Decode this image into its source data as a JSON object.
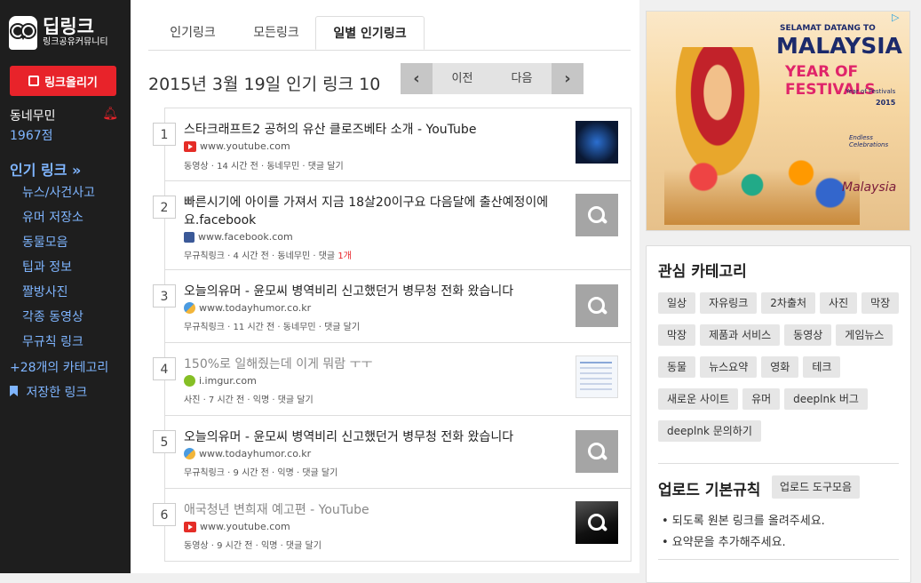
{
  "sidebar": {
    "logo_title": "딥링크",
    "logo_sub": "링크공유커뮤니티",
    "post_button": "링크올리기",
    "user_name": "동네무민",
    "user_points": "1967점",
    "nav_heading": "인기 링크",
    "categories": [
      "뉴스/사건사고",
      "유머 저장소",
      "동물모음",
      "팁과 정보",
      "짤방사진",
      "각종 동영상",
      "무규칙 링크"
    ],
    "more_categories": "+28개의 카테고리",
    "saved_links": "저장한 링크"
  },
  "tabs": [
    "인기링크",
    "모든링크",
    "일별 인기링크"
  ],
  "active_tab": "일별 인기링크",
  "date_title": "2015년 3월 19일 인기 링크 10",
  "pager": {
    "prev": "이전",
    "next": "다음"
  },
  "items": [
    {
      "rank": "1",
      "title": "스타크래프트2 공허의 유산 클로즈베타 소개 - YouTube",
      "domain": "www.youtube.com",
      "favicon": "youtube-icon",
      "meta": "동영상 · 14 시간 전 · 동네무민 · 댓글 달기",
      "meta_count": "",
      "visited": false,
      "thumb": "game-thumbnail"
    },
    {
      "rank": "2",
      "title": "빠른시기에 아이를 가져서 지금 18살20이구요 다음달에 출산예정이에요.facebook",
      "domain": "www.facebook.com",
      "favicon": "facebook-icon",
      "meta": "무규칙링크 · 4 시간 전 · 동네무민 · 댓글 ",
      "meta_count": "1개",
      "visited": false,
      "thumb": "placeholder"
    },
    {
      "rank": "3",
      "title": "오늘의유머 - 윤모씨 병역비리 신고했던거 병무청 전화 왔습니다",
      "domain": "www.todayhumor.co.kr",
      "favicon": "todayhumor-icon",
      "meta": "무규칙링크 · 11 시간 전 · 동네무민 · 댓글 달기",
      "meta_count": "",
      "visited": false,
      "thumb": "placeholder"
    },
    {
      "rank": "4",
      "title": "150%로 일해줬는데 이게 뭐람 ㅜㅜ",
      "domain": "i.imgur.com",
      "favicon": "imgur-icon",
      "meta": "사진 · 7 시간 전 · 익명 · 댓글 달기",
      "meta_count": "",
      "visited": true,
      "thumb": "screenshot-thumbnail"
    },
    {
      "rank": "5",
      "title": "오늘의유머 - 윤모씨 병역비리 신고했던거 병무청 전화 왔습니다",
      "domain": "www.todayhumor.co.kr",
      "favicon": "todayhumor-icon",
      "meta": "무규칙링크 · 9 시간 전 · 익명 · 댓글 달기",
      "meta_count": "",
      "visited": false,
      "thumb": "placeholder"
    },
    {
      "rank": "6",
      "title": "애국청년 변희재 예고편 - YouTube",
      "domain": "www.youtube.com",
      "favicon": "youtube-icon",
      "meta": "동영상 · 9 시간 전 · 익명 · 댓글 달기",
      "meta_count": "",
      "visited": true,
      "thumb": "dark-thumbnail"
    }
  ],
  "ad": {
    "line1": "SELAMAT DATANG TO",
    "line2": "MALAYSIA",
    "line3": "YEAR OF FESTIVALS",
    "line4": "Year of Festivals",
    "year": "2015",
    "tagline": "Endless Celebrations",
    "brand": "Malaysia"
  },
  "interest": {
    "title": "관심 카테고리",
    "chips": [
      "일상",
      "자유링크",
      "2차출처",
      "사진",
      "막장",
      "막장",
      "제품과 서비스",
      "동영상",
      "게임뉴스",
      "동물",
      "뉴스요약",
      "영화",
      "테크",
      "새로운 사이트",
      "유머",
      "deeplnk 버그",
      "deeplnk 문의하기"
    ]
  },
  "rules": {
    "title": "업로드 기본규칙",
    "tools_button": "업로드 도구모음",
    "items": [
      "• 되도록 원본 링크를 올려주세요.",
      "• 요약문을 추가해주세요."
    ]
  }
}
